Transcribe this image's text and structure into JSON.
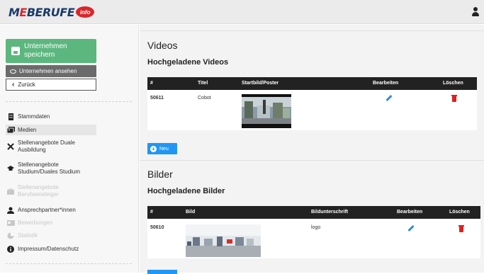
{
  "header": {
    "logo_text_me": "M",
    "logo_text_e": "E",
    "logo_text_rest": "BERUFE",
    "logo_badge": "info"
  },
  "sidebar": {
    "save_label": "Unternehmen speichern",
    "view_label": "Unternehmen ansehen",
    "back_label": "Zurück",
    "items": [
      {
        "label": "Stammdaten",
        "icon": "building-icon",
        "state": "normal"
      },
      {
        "label": "Medien",
        "icon": "photo-icon",
        "state": "active"
      },
      {
        "label": "Stellenangebote Duale Ausbildung",
        "icon": "tools-icon",
        "state": "normal"
      },
      {
        "label": "Stellenangebote Studium/Duales Studium",
        "icon": "graduation-cap-icon",
        "state": "normal"
      },
      {
        "label": "Stellenangebote Berufseinsteiger",
        "icon": "briefcase-icon",
        "state": "disabled"
      },
      {
        "label": "Ansprechpartner*innen",
        "icon": "user-icon",
        "state": "normal"
      },
      {
        "label": "Bewerbungen",
        "icon": "id-card-icon",
        "state": "disabled"
      },
      {
        "label": "Statistik",
        "icon": "chart-icon",
        "state": "disabled"
      },
      {
        "label": "Impressum/Datenschutz",
        "icon": "info-icon",
        "state": "normal"
      }
    ]
  },
  "videos": {
    "title": "Videos",
    "subtitle": "Hochgeladene Videos",
    "columns": [
      "#",
      "Titel",
      "Startbild/Poster",
      "Bearbeiten",
      "Löschen"
    ],
    "rows": [
      {
        "id": "50611",
        "title": "Cobot"
      }
    ],
    "new_label": "Neu"
  },
  "images": {
    "title": "Bilder",
    "subtitle": "Hochgeladene Bilder",
    "columns": [
      "#",
      "Bild",
      "Bildunterschrift",
      "Bearbeiten",
      "Löschen"
    ],
    "rows": [
      {
        "id": "50610",
        "caption": "logo"
      }
    ]
  },
  "colors": {
    "save_green": "#5cb77e",
    "view_gray": "#6b6b6b",
    "new_blue": "#2196f3",
    "edit_blue": "#2d8fd8",
    "delete_red": "#e02020",
    "table_head": "#222222"
  }
}
